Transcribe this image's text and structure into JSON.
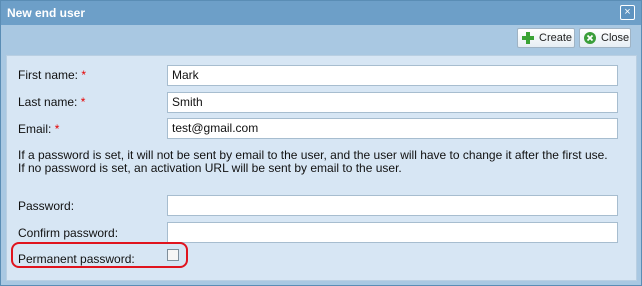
{
  "dialog": {
    "title": "New end user",
    "close_glyph": "×"
  },
  "toolbar": {
    "create_label": "Create",
    "close_label": "Close"
  },
  "form": {
    "first_name_label": "First name:",
    "first_name_value": "Mark",
    "last_name_label": "Last name:",
    "last_name_value": "Smith",
    "email_label": "Email:",
    "email_value": "test@gmail.com",
    "required_marker": "*",
    "info_line_1": "If a password is set, it will not be sent by email to the user, and the user will have to change it after the first use.",
    "info_line_2": "If no password is set, an activation URL will be sent by email to the user.",
    "password_label": "Password:",
    "password_value": "",
    "confirm_password_label": "Confirm password:",
    "confirm_password_value": "",
    "permanent_password_label": "Permanent password:",
    "permanent_password_checked": false
  },
  "icons": {
    "create": "plus-icon",
    "close": "close-circle-icon"
  },
  "colors": {
    "titlebar": "#6d9fc8",
    "panel": "#d7e6f4",
    "required": "#e60000",
    "highlight": "#e0141e"
  }
}
